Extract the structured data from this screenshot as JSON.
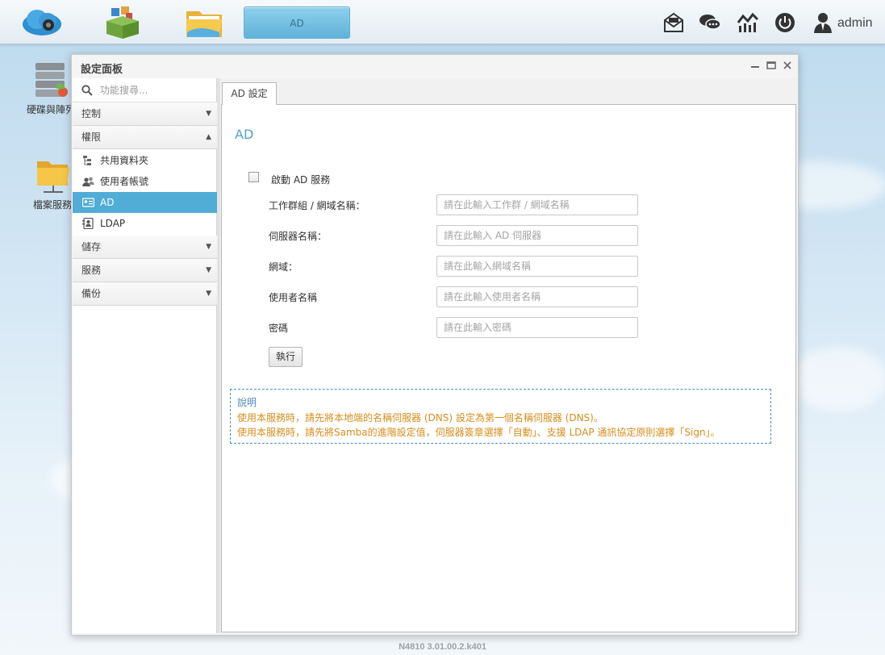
{
  "taskbar": {
    "apps": [
      {
        "name": "cloud-app",
        "icon": "cloud-icon"
      },
      {
        "name": "app-center",
        "icon": "boxes-icon"
      },
      {
        "name": "file-manager",
        "icon": "folder-icon"
      }
    ],
    "active_task_label": "AD",
    "icons": [
      "mail-icon",
      "chat-icon",
      "monitor-icon",
      "power-icon",
      "user-icon"
    ],
    "username": "admin"
  },
  "desktop": {
    "icons": [
      {
        "label": "硬碟與陣列",
        "icon": "disk-array-icon"
      },
      {
        "label": "檔案服務",
        "icon": "file-service-icon"
      }
    ]
  },
  "window": {
    "title": "設定面板",
    "controls": {
      "minimize": "minimize-icon",
      "maximize": "maximize-icon",
      "close": "close-icon"
    }
  },
  "sidebar": {
    "search_placeholder": "功能搜尋...",
    "categories": {
      "control": "控制",
      "privilege": "權限",
      "storage": "儲存",
      "service": "服務",
      "backup": "備份"
    },
    "privilege_items": [
      {
        "label": "共用資料夾",
        "icon": "shared-folder-icon"
      },
      {
        "label": "使用者帳號",
        "icon": "users-icon"
      },
      {
        "label": "AD",
        "icon": "ad-icon"
      },
      {
        "label": "LDAP",
        "icon": "ldap-icon"
      }
    ]
  },
  "main": {
    "tab_label": "AD 設定",
    "title": "AD",
    "enable_label": "啟動 AD 服務",
    "enable_checked": false,
    "fields": [
      {
        "label": "工作群組 / 網域名稱：",
        "placeholder": "請在此輸入工作群 / 網域名稱",
        "value": ""
      },
      {
        "label": "伺服器名稱：",
        "placeholder": "請在此輸入 AD 伺服器",
        "value": ""
      },
      {
        "label": "網域：",
        "placeholder": "請在此輸入網域名稱",
        "value": ""
      },
      {
        "label": "使用者名稱",
        "placeholder": "請在此輸入使用者名稱",
        "value": ""
      },
      {
        "label": "密碼",
        "placeholder": "請在此輸入密碼",
        "value": ""
      }
    ],
    "execute_label": "執行",
    "note": {
      "title": "說明",
      "lines": [
        "使用本服務時，請先將本地端的名稱伺服器 (DNS) 設定為第一個名稱伺服器 (DNS)。",
        "使用本服務時，請先將Samba的進階設定值，伺服器簽章選擇「自動」、支援 LDAP 通訊協定原則選擇「Sign」。"
      ]
    }
  },
  "footer": {
    "version": "N4810   3.01.00.2.k401"
  },
  "colors": {
    "accent": "#51acd6",
    "note_text": "#d68d1c",
    "title": "#4ea3c9"
  }
}
